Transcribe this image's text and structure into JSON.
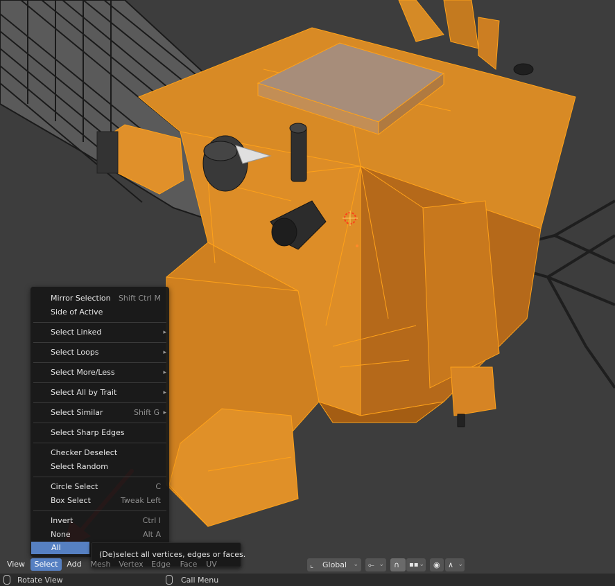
{
  "select_menu": {
    "items": [
      {
        "label": "Mirror Selection",
        "shortcut": "Shift Ctrl M",
        "submenu": false
      },
      {
        "label": "Side of Active",
        "shortcut": "",
        "submenu": false
      },
      {
        "label": "Select Linked",
        "shortcut": "",
        "submenu": true
      },
      {
        "label": "Select Loops",
        "shortcut": "",
        "submenu": true
      },
      {
        "label": "Select More/Less",
        "shortcut": "",
        "submenu": true
      },
      {
        "label": "Select All by Trait",
        "shortcut": "",
        "submenu": true
      },
      {
        "label": "Select Similar",
        "shortcut": "Shift G",
        "submenu": true
      },
      {
        "label": "Select Sharp Edges",
        "shortcut": "",
        "submenu": false
      },
      {
        "label": "Checker Deselect",
        "shortcut": "",
        "submenu": false
      },
      {
        "label": "Select Random",
        "shortcut": "",
        "submenu": false
      },
      {
        "label": "Circle Select",
        "shortcut": "C",
        "submenu": false
      },
      {
        "label": "Box Select",
        "shortcut": "Tweak Left",
        "submenu": false
      },
      {
        "label": "Invert",
        "shortcut": "Ctrl I",
        "submenu": false
      },
      {
        "label": "None",
        "shortcut": "Alt A",
        "submenu": false
      },
      {
        "label": "All",
        "shortcut": "",
        "submenu": false,
        "highlighted": true
      }
    ]
  },
  "tooltip": {
    "text": "(De)select all vertices, edges or faces."
  },
  "header": {
    "view": "View",
    "select": "Select",
    "add": "Add",
    "mesh": "Mesh",
    "vertex": "Vertex",
    "edge": "Edge",
    "face": "Face",
    "uv": "UV",
    "orientation": "Global"
  },
  "statusbar": {
    "left": "Rotate View",
    "right": "Call Menu"
  },
  "colors": {
    "accent": "#5680c2",
    "selected_mesh": "#d9861f",
    "wire_highlight": "#ffa21a",
    "annotation_arrow": "#e8191a"
  },
  "icons": [
    "transform-orientation-icon",
    "pivot-point-icon",
    "snap-magnet-icon",
    "snap-grid-icon",
    "proportional-edit-icon",
    "falloff-curve-icon",
    "3d-cursor-icon",
    "mouse-left-icon",
    "mouse-right-icon"
  ]
}
